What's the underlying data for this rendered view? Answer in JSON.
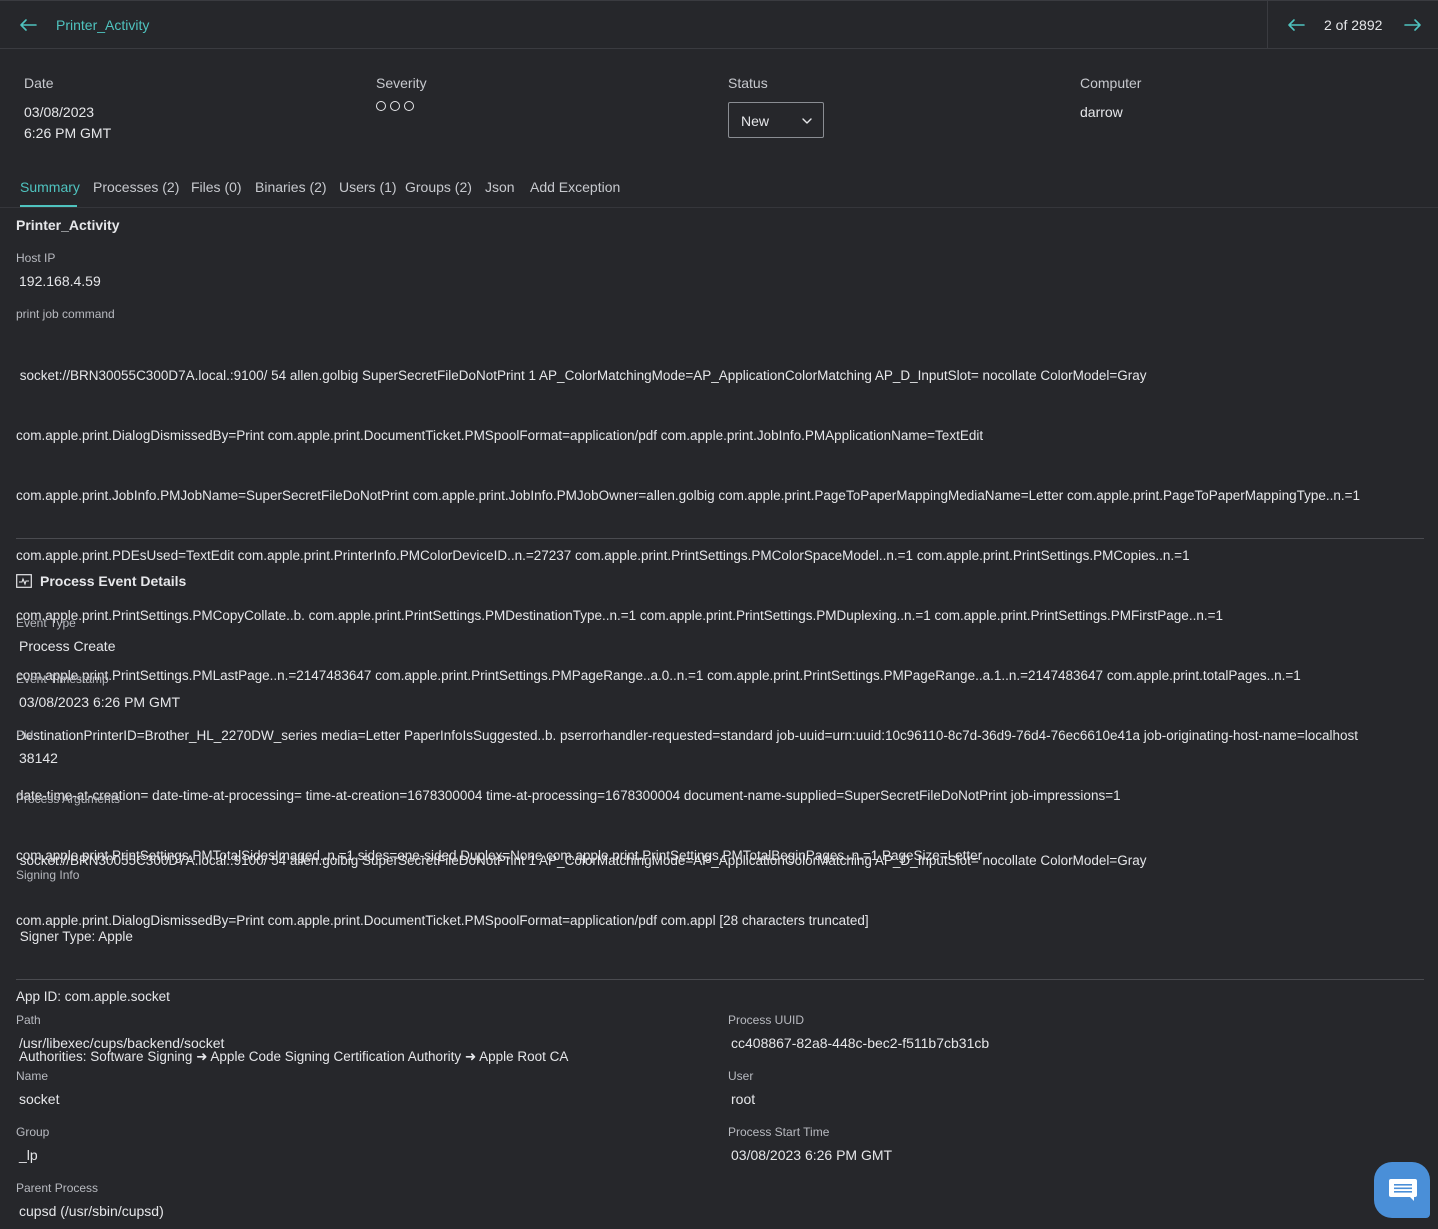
{
  "header": {
    "title": "Printer_Activity",
    "pager": "2 of 2892"
  },
  "meta": {
    "date_label": "Date",
    "date_value": "03/08/2023",
    "time_value": "6:26 PM GMT",
    "severity_label": "Severity",
    "severity_level": 0,
    "status_label": "Status",
    "status_value": "New",
    "computer_label": "Computer",
    "computer_value": "darrow"
  },
  "tabs": [
    {
      "label": "Summary"
    },
    {
      "label": "Processes (2)"
    },
    {
      "label": "Files (0)"
    },
    {
      "label": "Binaries (2)"
    },
    {
      "label": "Users (1)"
    },
    {
      "label": "Groups (2)"
    },
    {
      "label": "Json"
    },
    {
      "label": "Add Exception"
    }
  ],
  "summary": {
    "title": "Printer_Activity",
    "host_ip_label": "Host IP",
    "host_ip": "192.168.4.59",
    "print_job_label": "print job command",
    "print_job_lines": [
      " socket://BRN30055C300D7A.local.:9100/ 54 allen.golbig SuperSecretFileDoNotPrint 1 AP_ColorMatchingMode=AP_ApplicationColorMatching AP_D_InputSlot= nocollate ColorModel=Gray",
      "com.apple.print.DialogDismissedBy=Print com.apple.print.DocumentTicket.PMSpoolFormat=application/pdf com.apple.print.JobInfo.PMApplicationName=TextEdit",
      "com.apple.print.JobInfo.PMJobName=SuperSecretFileDoNotPrint com.apple.print.JobInfo.PMJobOwner=allen.golbig com.apple.print.PageToPaperMappingMediaName=Letter com.apple.print.PageToPaperMappingType..n.=1",
      "com.apple.print.PDEsUsed=TextEdit com.apple.print.PrinterInfo.PMColorDeviceID..n.=27237 com.apple.print.PrintSettings.PMColorSpaceModel..n.=1 com.apple.print.PrintSettings.PMCopies..n.=1",
      "com.apple.print.PrintSettings.PMCopyCollate..b. com.apple.print.PrintSettings.PMDestinationType..n.=1 com.apple.print.PrintSettings.PMDuplexing..n.=1 com.apple.print.PrintSettings.PMFirstPage..n.=1",
      "com.apple.print.PrintSettings.PMLastPage..n.=2147483647 com.apple.print.PrintSettings.PMPageRange..a.0..n.=1 com.apple.print.PrintSettings.PMPageRange..a.1..n.=2147483647 com.apple.print.totalPages..n.=1",
      "DestinationPrinterID=Brother_HL_2270DW_series media=Letter PaperInfoIsSuggested..b. pserrorhandler-requested=standard job-uuid=urn:uuid:10c96110-8c7d-36d9-76d4-76ec6610e41a job-originating-host-name=localhost",
      "date-time-at-creation= date-time-at-processing= time-at-creation=1678300004 time-at-processing=1678300004 document-name-supplied=SuperSecretFileDoNotPrint job-impressions=1",
      "com.apple.print.PrintSettings.PMTotalSidesImaged..n.=1 sides=one-sided Duplex=None com.apple.print.PrintSettings.PMTotalBeginPages..n.=1 PageSize=Letter"
    ]
  },
  "process_event": {
    "title": "Process Event Details",
    "event_type_label": "Event Type",
    "event_type": "Process Create",
    "event_timestamp_label": "Event Timestamp",
    "event_timestamp": "03/08/2023 6:26 PM GMT",
    "pid_label": "Pid",
    "pid": "38142",
    "args_label": "Process Arguments",
    "args_lines": [
      " socket://BRN30055C300D7A.local.:9100/ 54 allen.golbig SuperSecretFileDoNotPrint 1 AP_ColorMatchingMode=AP_ApplicationColorMatching AP_D_InputSlot= nocollate ColorModel=Gray",
      "com.apple.print.DialogDismissedBy=Print com.apple.print.DocumentTicket.PMSpoolFormat=application/pdf com.appl [28 characters truncated]"
    ],
    "signing_label": "Signing Info",
    "signer_type": " Signer Type: Apple",
    "app_id": "App ID: com.apple.socket",
    "authorities": " Authorities: Software Signing ➜ Apple Code Signing Certification Authority ➜ Apple Root CA"
  },
  "details": {
    "path_label": "Path",
    "path": "/usr/libexec/cups/backend/socket",
    "name_label": "Name",
    "name": "socket",
    "group_label": "Group",
    "group": "_lp",
    "parent_label": "Parent Process",
    "parent": "cupsd (/usr/sbin/cupsd)",
    "uuid_label": "Process UUID",
    "uuid": "cc408867-82a8-448c-bec2-f511b7cb31cb",
    "user_label": "User",
    "user": "root",
    "start_label": "Process Start Time",
    "start": "03/08/2023 6:26 PM GMT"
  },
  "colors": {
    "accent": "#4fc3bf",
    "background": "#26272b",
    "chat": "#4a8fd8"
  }
}
